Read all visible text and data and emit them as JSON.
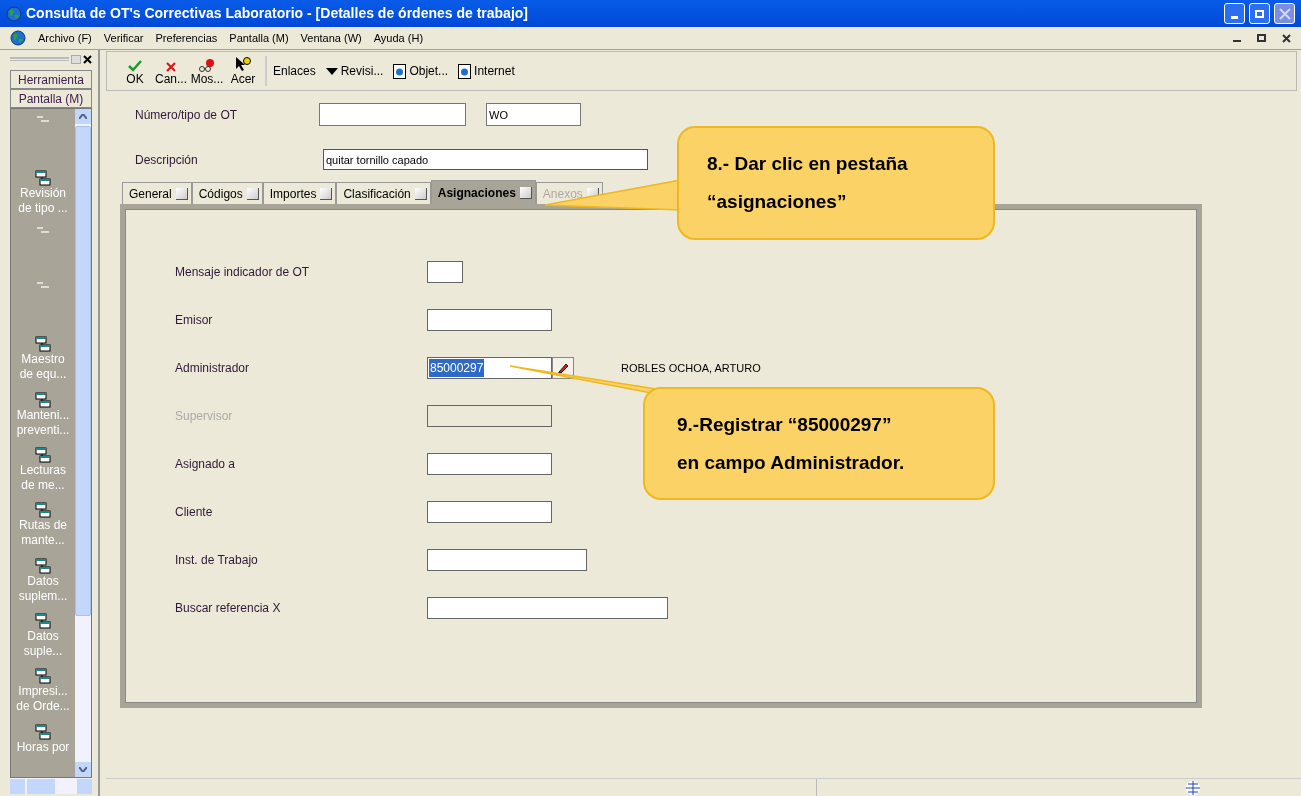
{
  "window": {
    "title": "Consulta de OT's Correctivas Laboratorio - [Detalles de órdenes de trabajo]"
  },
  "menu": [
    "Archivo (F)",
    "Verificar",
    "Preferencias",
    "Pantalla (M)",
    "Ventana (W)",
    "Ayuda (H)"
  ],
  "side_panel": {
    "tabs": [
      "Herramienta",
      "Pantalla (M)"
    ],
    "items": [
      {
        "disabled": true
      },
      {
        "label": "Revisión de tipo ...",
        "disabled": false
      },
      {
        "disabled": true
      },
      {
        "disabled": true
      },
      {
        "label": "Maestro de equ...",
        "disabled": false
      },
      {
        "label": "Manteni... preventi...",
        "disabled": false
      },
      {
        "label": "Lecturas de me...",
        "disabled": false
      },
      {
        "label": "Rutas de mante...",
        "disabled": false
      },
      {
        "label": "Datos suplem...",
        "disabled": false
      },
      {
        "label": "Datos suple...",
        "disabled": false
      },
      {
        "label": "Impresi... de Orde...",
        "disabled": false
      },
      {
        "label": "Horas por",
        "disabled": false
      }
    ]
  },
  "toolbar": [
    {
      "label": "OK",
      "kind": "ok"
    },
    {
      "label": "Can...",
      "kind": "cancel"
    },
    {
      "label": "Mos...",
      "kind": "show"
    },
    {
      "label": "Acer",
      "kind": "help"
    }
  ],
  "links_bar": [
    {
      "label": "Enlaces",
      "kind": "text"
    },
    {
      "label": "Revisi...",
      "kind": "dropdown"
    },
    {
      "label": "Objet...",
      "kind": "doc"
    },
    {
      "label": "Internet",
      "kind": "doc"
    }
  ],
  "header": {
    "number_label": "Número/tipo de OT",
    "type_value": "WO",
    "description_label": "Descripción",
    "description_value": "quitar tornillo capado"
  },
  "tabs": [
    {
      "label": "General",
      "selected": false,
      "disabled": false
    },
    {
      "label": "Códigos",
      "selected": false,
      "disabled": false
    },
    {
      "label": "Importes",
      "selected": false,
      "disabled": false
    },
    {
      "label": "Clasificación",
      "selected": false,
      "disabled": false
    },
    {
      "label": "Asignaciones",
      "selected": true,
      "disabled": false
    },
    {
      "label": "Anexos",
      "selected": false,
      "disabled": true
    }
  ],
  "fields": [
    {
      "label": "Mensaje indicador de OT",
      "disabled": false
    },
    {
      "label": "Emisor",
      "disabled": false
    },
    {
      "label": "Administrador",
      "value": "85000297",
      "disabled": false,
      "highlighted": true,
      "lookup": true,
      "name": "ROBLES OCHOA, ARTURO"
    },
    {
      "label": "Supervisor",
      "disabled": true
    },
    {
      "label": "Asignado a",
      "disabled": false
    },
    {
      "label": "Cliente",
      "disabled": false
    },
    {
      "label": "Inst. de Trabajo",
      "disabled": false
    },
    {
      "label": "Buscar referencia X",
      "disabled": false
    }
  ],
  "callouts": [
    {
      "lines": [
        "8.- Dar clic en pestaña",
        "“asignaciones”"
      ]
    },
    {
      "lines": [
        "9.-Registrar “85000297”",
        "en campo Administrador."
      ]
    }
  ]
}
